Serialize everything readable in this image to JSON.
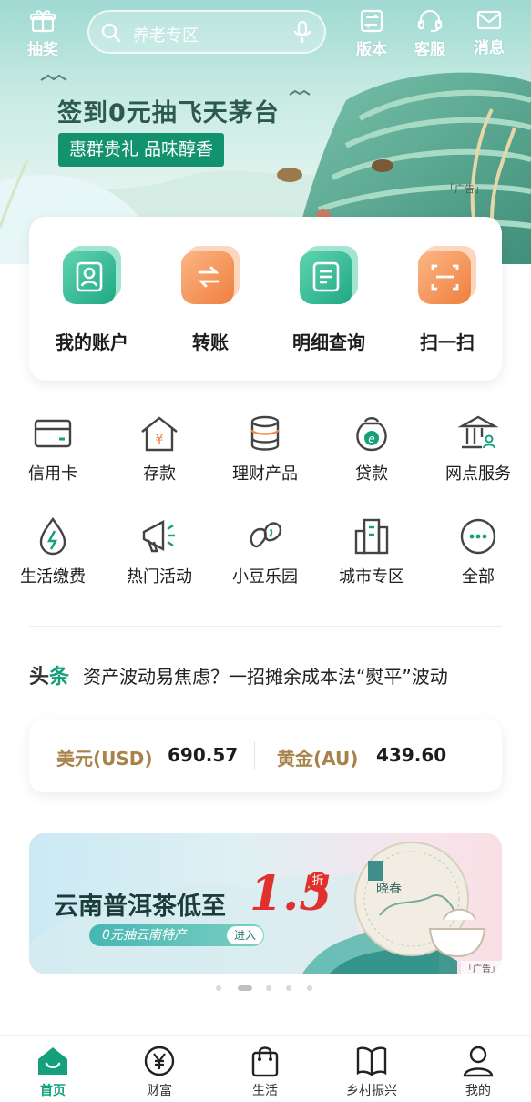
{
  "top_bar": {
    "lottery_label": "抽奖",
    "search_placeholder": "养老专区",
    "version_label": "版本",
    "service_label": "客服",
    "message_label": "消息"
  },
  "hero_banner": {
    "title": "签到0元抽飞天茅台",
    "tag": "惠群贵礼 品味醇香",
    "ad_label": "「广告」"
  },
  "quick_actions": [
    {
      "label": "我的账户",
      "icon": "account-icon"
    },
    {
      "label": "转账",
      "icon": "transfer-icon"
    },
    {
      "label": "明细查询",
      "icon": "statement-icon"
    },
    {
      "label": "扫一扫",
      "icon": "scan-icon"
    }
  ],
  "services": [
    {
      "label": "信用卡",
      "icon": "credit-card-icon"
    },
    {
      "label": "存款",
      "icon": "deposit-icon"
    },
    {
      "label": "理财产品",
      "icon": "wealth-product-icon"
    },
    {
      "label": "贷款",
      "icon": "loan-icon"
    },
    {
      "label": "网点服务",
      "icon": "branch-service-icon"
    },
    {
      "label": "生活缴费",
      "icon": "utility-payment-icon"
    },
    {
      "label": "热门活动",
      "icon": "hot-activity-icon"
    },
    {
      "label": "小豆乐园",
      "icon": "bean-park-icon"
    },
    {
      "label": "城市专区",
      "icon": "city-zone-icon"
    },
    {
      "label": "全部",
      "icon": "more-icon"
    }
  ],
  "news": {
    "tag_a": "头",
    "tag_b": "条",
    "headline": "资产波动易焦虑？一招摊余成本法“熨平”波动"
  },
  "rates": [
    {
      "name": "美元(USD)",
      "value": "690.57"
    },
    {
      "name": "黄金(AU)",
      "value": "439.60"
    }
  ],
  "promo_banner": {
    "title": "云南普洱茶低至",
    "number": "1.5",
    "discount": "折",
    "pill_text": "0元抽云南特产",
    "pill_button": "进入",
    "tea_label": "晓春",
    "ad_label": "「广告」"
  },
  "carousel": {
    "count": 5,
    "active": 1
  },
  "tab_bar": [
    {
      "label": "首页",
      "icon": "home-icon",
      "active": true
    },
    {
      "label": "财富",
      "icon": "wealth-icon",
      "active": false
    },
    {
      "label": "生活",
      "icon": "shopping-bag-icon",
      "active": false
    },
    {
      "label": "乡村振兴",
      "icon": "rural-book-icon",
      "active": false
    },
    {
      "label": "我的",
      "icon": "user-icon",
      "active": false
    }
  ],
  "colors": {
    "brand_green": "#13a07a",
    "accent_orange": "#f08a4b",
    "gold_text": "#a88249",
    "promo_red": "#e0312e"
  }
}
